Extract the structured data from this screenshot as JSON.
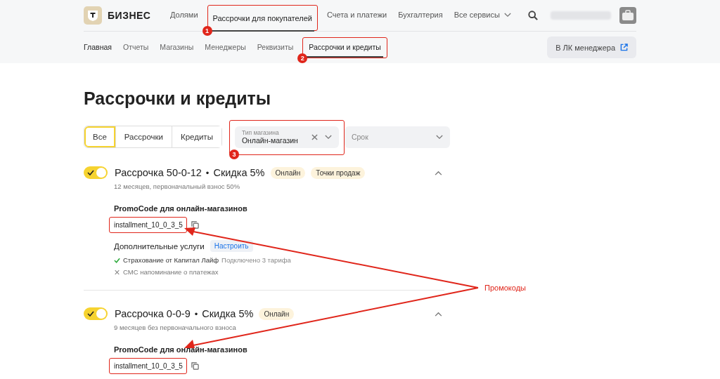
{
  "brand": {
    "name": "БИЗНЕС"
  },
  "top_nav": [
    {
      "label": "Долями",
      "selected": false
    },
    {
      "label": "Рассрочки для покупателей",
      "selected": true,
      "annotation": "1"
    },
    {
      "label": "Счета и платежи",
      "selected": false
    },
    {
      "label": "Бухгалтерия",
      "selected": false
    },
    {
      "label": "Все сервисы",
      "selected": false,
      "dropdown": true
    }
  ],
  "sub_nav": [
    {
      "label": "Главная",
      "selected": false
    },
    {
      "label": "Отчеты",
      "selected": false
    },
    {
      "label": "Магазины",
      "selected": false
    },
    {
      "label": "Менеджеры",
      "selected": false
    },
    {
      "label": "Реквизиты",
      "selected": false
    },
    {
      "label": "Рассрочки и кредиты",
      "selected": true,
      "annotation": "2"
    }
  ],
  "manager_button": {
    "label": "В ЛК менеджера"
  },
  "page_title": "Рассрочки и кредиты",
  "segments": [
    {
      "label": "Все",
      "selected": true
    },
    {
      "label": "Рассрочки",
      "selected": false
    },
    {
      "label": "Кредиты",
      "selected": false
    }
  ],
  "filters": [
    {
      "label": "Тип магазина",
      "value": "Онлайн-магазин",
      "clearable": true,
      "annotation": "3"
    },
    {
      "placeholder": "Срок",
      "clearable": false
    }
  ],
  "offers": [
    {
      "on": true,
      "expanded": true,
      "name": "Рассрочка 50-0-12",
      "separator": "•",
      "discount": "Скидка 5%",
      "tags": [
        "Онлайн",
        "Точки продаж"
      ],
      "subtitle": "12 месяцев, первоначальный взнос 50%",
      "promo_label": "PromoCode для онлайн-магазинов",
      "promo_code": "installment_10_0_3_5",
      "promo_highlighted": true,
      "services": {
        "title": "Дополнительные услуги",
        "action": "Настроить",
        "items": [
          {
            "name": "Страхование от Капитал Лайф",
            "note": "Подключено 3 тарифа",
            "enabled": true
          },
          {
            "name": "СМС напоминание о платежах",
            "enabled": false
          }
        ]
      }
    },
    {
      "on": true,
      "expanded": true,
      "name": "Рассрочка 0-0-9",
      "separator": "•",
      "discount": "Скидка 5%",
      "tags": [
        "Онлайн"
      ],
      "subtitle": "9 месяцев без первоначального взноса",
      "promo_label": "PromoCode для онлайн-магазинов",
      "promo_code": "installment_10_0_3_5",
      "promo_highlighted": true
    }
  ],
  "callout": {
    "label": "Промокоды"
  }
}
